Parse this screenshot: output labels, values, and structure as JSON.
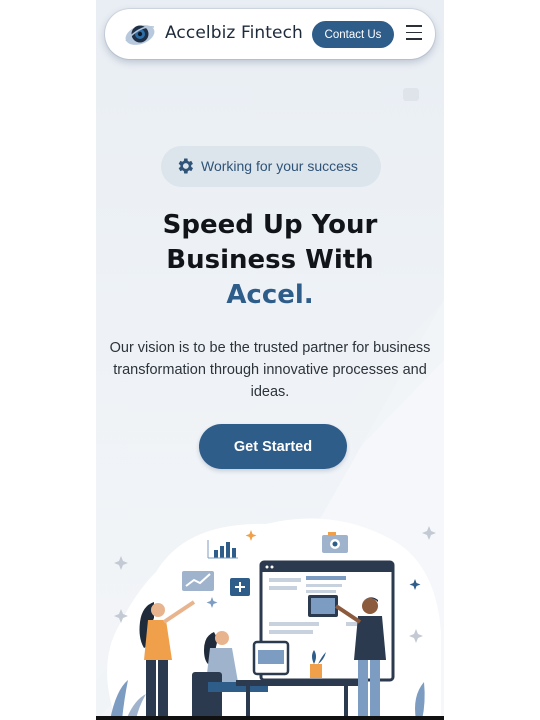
{
  "header": {
    "brand": "Accelbiz Fintech",
    "contact_label": "Contact Us"
  },
  "hero": {
    "badge_text": "Working for your success",
    "headline_line1": "Speed Up Your",
    "headline_line2": "Business With",
    "headline_accent": "Accel.",
    "description": "Our vision is to be the trusted partner for business transformation through innovative processes and ideas.",
    "cta_label": "Get Started"
  },
  "icons": {
    "logo": "logo-icon",
    "menu": "hamburger-menu-icon",
    "badge": "gear-icon"
  },
  "colors": {
    "primary": "#2f5d8a",
    "badge_bg": "#dce4ec",
    "text_dark": "#111418",
    "accent_orange": "#f0a04b"
  }
}
